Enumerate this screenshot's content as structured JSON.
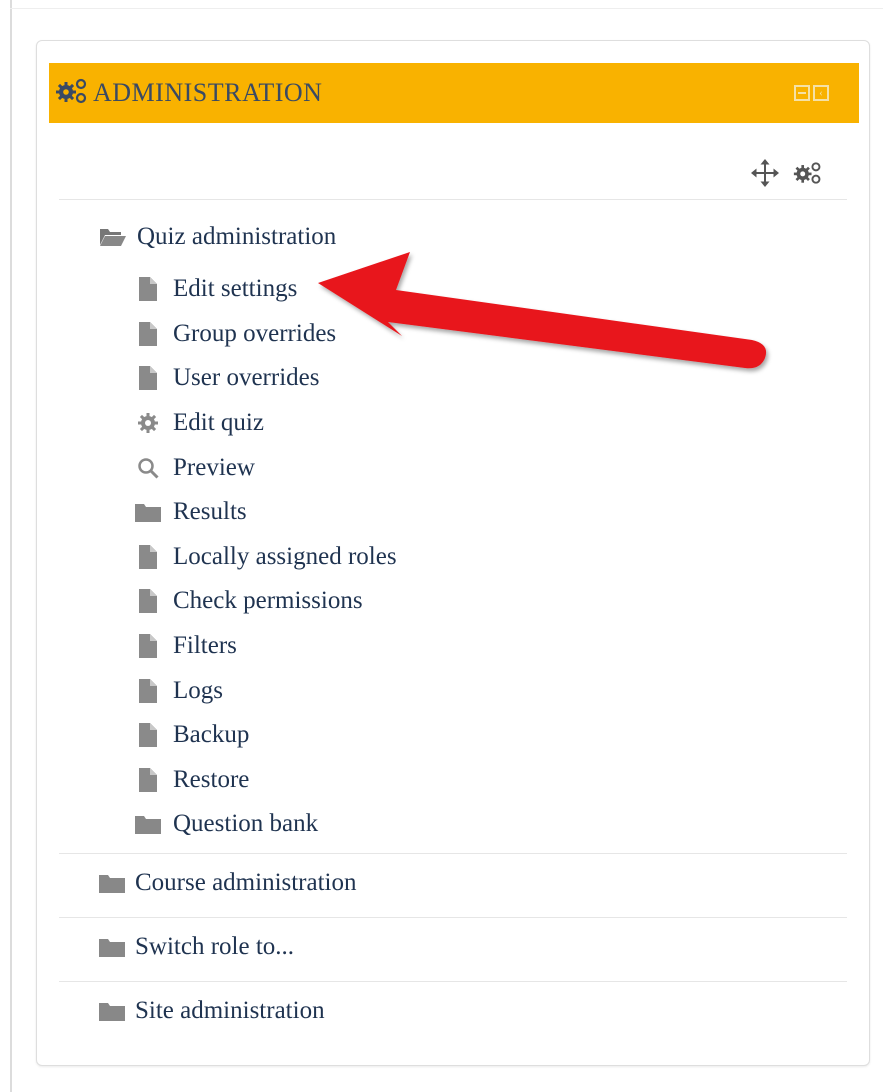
{
  "block": {
    "title": "ADMINISTRATION",
    "accent_color": "#f9b200",
    "header_icon": "cogs-icon",
    "controls": [
      "collapse-icon",
      "dock-icon"
    ],
    "tools": [
      "move-icon",
      "cogs-icon"
    ]
  },
  "tree": {
    "root": {
      "label": "Quiz administration",
      "icon": "folder-open-icon"
    },
    "items": [
      {
        "label": "Edit settings",
        "icon": "file-icon"
      },
      {
        "label": "Group overrides",
        "icon": "file-icon"
      },
      {
        "label": "User overrides",
        "icon": "file-icon"
      },
      {
        "label": "Edit quiz",
        "icon": "gear-icon"
      },
      {
        "label": "Preview",
        "icon": "search-icon"
      },
      {
        "label": "Results",
        "icon": "folder-icon"
      },
      {
        "label": "Locally assigned roles",
        "icon": "file-icon"
      },
      {
        "label": "Check permissions",
        "icon": "file-icon"
      },
      {
        "label": "Filters",
        "icon": "file-icon"
      },
      {
        "label": "Logs",
        "icon": "file-icon"
      },
      {
        "label": "Backup",
        "icon": "file-icon"
      },
      {
        "label": "Restore",
        "icon": "file-icon"
      },
      {
        "label": "Question bank",
        "icon": "folder-icon"
      }
    ],
    "categories": [
      {
        "label": "Course administration",
        "icon": "folder-icon"
      },
      {
        "label": "Switch role to...",
        "icon": "folder-icon"
      },
      {
        "label": "Site administration",
        "icon": "folder-icon"
      }
    ]
  },
  "annotation": {
    "icon": "red-arrow-icon",
    "color": "#e8141b"
  }
}
